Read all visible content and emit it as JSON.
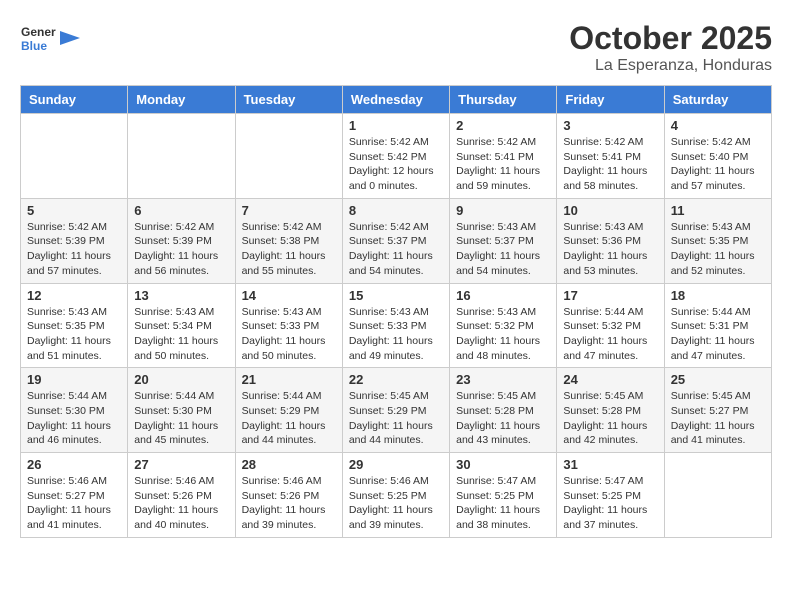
{
  "header": {
    "logo_line1": "General",
    "logo_line2": "Blue",
    "month": "October 2025",
    "location": "La Esperanza, Honduras"
  },
  "days_of_week": [
    "Sunday",
    "Monday",
    "Tuesday",
    "Wednesday",
    "Thursday",
    "Friday",
    "Saturday"
  ],
  "weeks": [
    [
      {
        "num": "",
        "info": ""
      },
      {
        "num": "",
        "info": ""
      },
      {
        "num": "",
        "info": ""
      },
      {
        "num": "1",
        "info": "Sunrise: 5:42 AM\nSunset: 5:42 PM\nDaylight: 12 hours\nand 0 minutes."
      },
      {
        "num": "2",
        "info": "Sunrise: 5:42 AM\nSunset: 5:41 PM\nDaylight: 11 hours\nand 59 minutes."
      },
      {
        "num": "3",
        "info": "Sunrise: 5:42 AM\nSunset: 5:41 PM\nDaylight: 11 hours\nand 58 minutes."
      },
      {
        "num": "4",
        "info": "Sunrise: 5:42 AM\nSunset: 5:40 PM\nDaylight: 11 hours\nand 57 minutes."
      }
    ],
    [
      {
        "num": "5",
        "info": "Sunrise: 5:42 AM\nSunset: 5:39 PM\nDaylight: 11 hours\nand 57 minutes."
      },
      {
        "num": "6",
        "info": "Sunrise: 5:42 AM\nSunset: 5:39 PM\nDaylight: 11 hours\nand 56 minutes."
      },
      {
        "num": "7",
        "info": "Sunrise: 5:42 AM\nSunset: 5:38 PM\nDaylight: 11 hours\nand 55 minutes."
      },
      {
        "num": "8",
        "info": "Sunrise: 5:42 AM\nSunset: 5:37 PM\nDaylight: 11 hours\nand 54 minutes."
      },
      {
        "num": "9",
        "info": "Sunrise: 5:43 AM\nSunset: 5:37 PM\nDaylight: 11 hours\nand 54 minutes."
      },
      {
        "num": "10",
        "info": "Sunrise: 5:43 AM\nSunset: 5:36 PM\nDaylight: 11 hours\nand 53 minutes."
      },
      {
        "num": "11",
        "info": "Sunrise: 5:43 AM\nSunset: 5:35 PM\nDaylight: 11 hours\nand 52 minutes."
      }
    ],
    [
      {
        "num": "12",
        "info": "Sunrise: 5:43 AM\nSunset: 5:35 PM\nDaylight: 11 hours\nand 51 minutes."
      },
      {
        "num": "13",
        "info": "Sunrise: 5:43 AM\nSunset: 5:34 PM\nDaylight: 11 hours\nand 50 minutes."
      },
      {
        "num": "14",
        "info": "Sunrise: 5:43 AM\nSunset: 5:33 PM\nDaylight: 11 hours\nand 50 minutes."
      },
      {
        "num": "15",
        "info": "Sunrise: 5:43 AM\nSunset: 5:33 PM\nDaylight: 11 hours\nand 49 minutes."
      },
      {
        "num": "16",
        "info": "Sunrise: 5:43 AM\nSunset: 5:32 PM\nDaylight: 11 hours\nand 48 minutes."
      },
      {
        "num": "17",
        "info": "Sunrise: 5:44 AM\nSunset: 5:32 PM\nDaylight: 11 hours\nand 47 minutes."
      },
      {
        "num": "18",
        "info": "Sunrise: 5:44 AM\nSunset: 5:31 PM\nDaylight: 11 hours\nand 47 minutes."
      }
    ],
    [
      {
        "num": "19",
        "info": "Sunrise: 5:44 AM\nSunset: 5:30 PM\nDaylight: 11 hours\nand 46 minutes."
      },
      {
        "num": "20",
        "info": "Sunrise: 5:44 AM\nSunset: 5:30 PM\nDaylight: 11 hours\nand 45 minutes."
      },
      {
        "num": "21",
        "info": "Sunrise: 5:44 AM\nSunset: 5:29 PM\nDaylight: 11 hours\nand 44 minutes."
      },
      {
        "num": "22",
        "info": "Sunrise: 5:45 AM\nSunset: 5:29 PM\nDaylight: 11 hours\nand 44 minutes."
      },
      {
        "num": "23",
        "info": "Sunrise: 5:45 AM\nSunset: 5:28 PM\nDaylight: 11 hours\nand 43 minutes."
      },
      {
        "num": "24",
        "info": "Sunrise: 5:45 AM\nSunset: 5:28 PM\nDaylight: 11 hours\nand 42 minutes."
      },
      {
        "num": "25",
        "info": "Sunrise: 5:45 AM\nSunset: 5:27 PM\nDaylight: 11 hours\nand 41 minutes."
      }
    ],
    [
      {
        "num": "26",
        "info": "Sunrise: 5:46 AM\nSunset: 5:27 PM\nDaylight: 11 hours\nand 41 minutes."
      },
      {
        "num": "27",
        "info": "Sunrise: 5:46 AM\nSunset: 5:26 PM\nDaylight: 11 hours\nand 40 minutes."
      },
      {
        "num": "28",
        "info": "Sunrise: 5:46 AM\nSunset: 5:26 PM\nDaylight: 11 hours\nand 39 minutes."
      },
      {
        "num": "29",
        "info": "Sunrise: 5:46 AM\nSunset: 5:25 PM\nDaylight: 11 hours\nand 39 minutes."
      },
      {
        "num": "30",
        "info": "Sunrise: 5:47 AM\nSunset: 5:25 PM\nDaylight: 11 hours\nand 38 minutes."
      },
      {
        "num": "31",
        "info": "Sunrise: 5:47 AM\nSunset: 5:25 PM\nDaylight: 11 hours\nand 37 minutes."
      },
      {
        "num": "",
        "info": ""
      }
    ]
  ]
}
